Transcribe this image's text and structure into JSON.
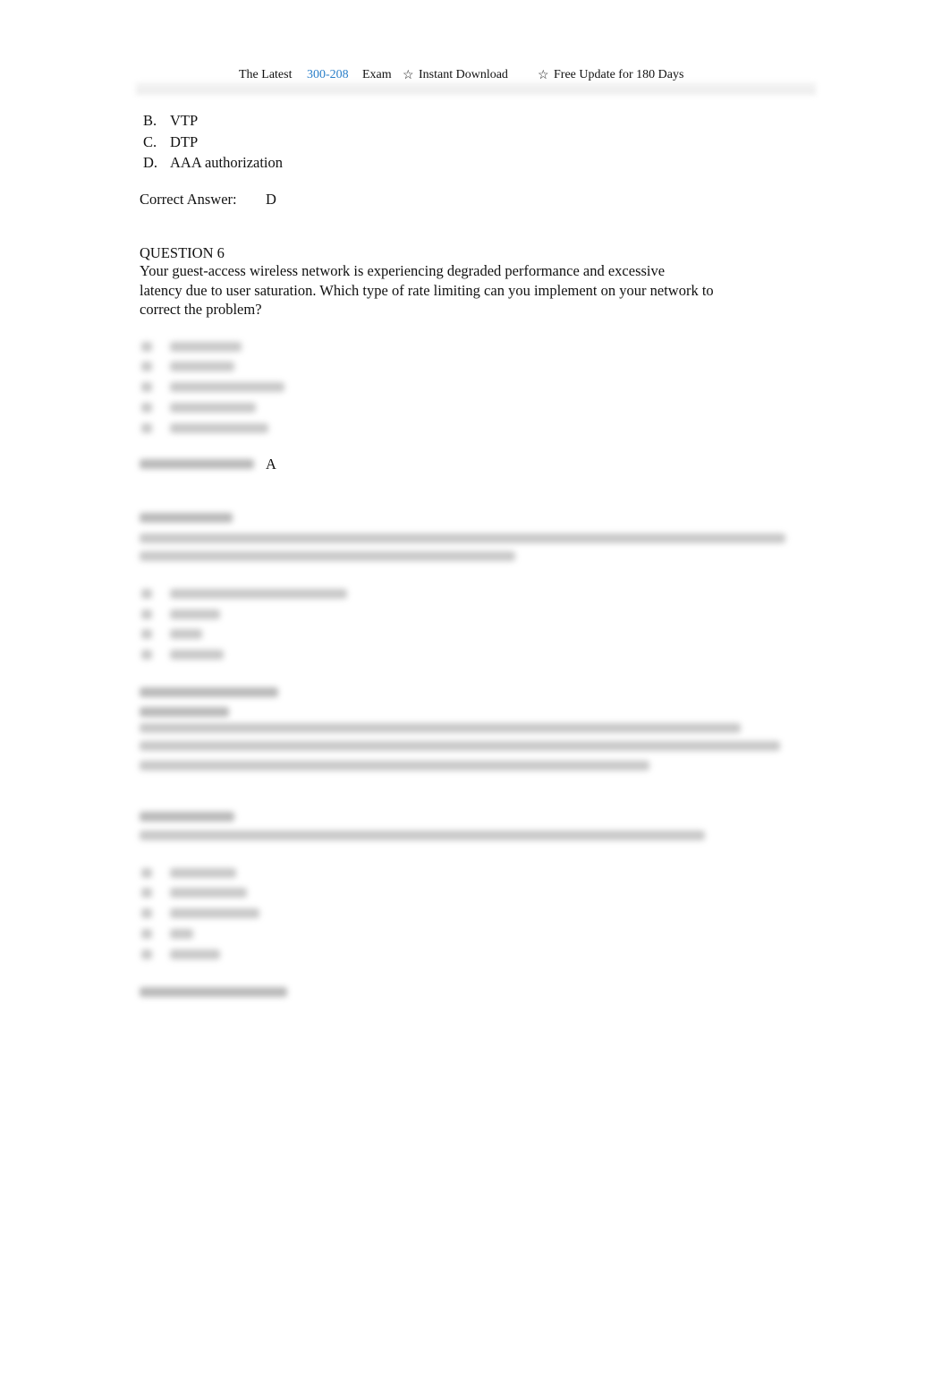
{
  "header": {
    "prefix": "The Latest",
    "exam_code": "300-208",
    "exam_word": "Exam",
    "star_icon": "☆",
    "instant": "Instant Download",
    "update": "Free Update for 180 Days",
    "accent_color": "#2a7fc9"
  },
  "question5": {
    "options": [
      {
        "letter": "B.",
        "text": "VTP"
      },
      {
        "letter": "C.",
        "text": "DTP"
      },
      {
        "letter": "D.",
        "text": "AAA authorization"
      }
    ],
    "answer_label": "Correct Answer:",
    "answer": "D"
  },
  "question6": {
    "title": "QUESTION 6",
    "lines": [
      "Your guest-access wireless network is experiencing degraded performance and excessive",
      "latency due to user saturation. Which type of rate limiting can you implement on your network to",
      "correct the problem?"
    ],
    "answer": "A"
  }
}
